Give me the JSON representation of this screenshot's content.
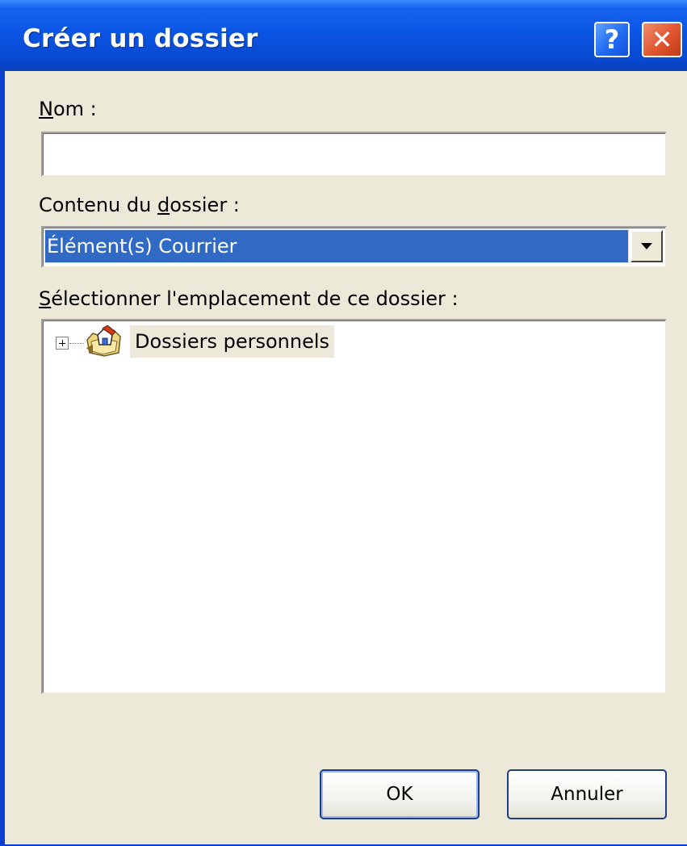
{
  "window": {
    "title": "Créer un dossier",
    "help_label": "?",
    "close_label": "✕"
  },
  "form": {
    "name_label_mnemonic": "N",
    "name_label_rest": "om :",
    "name_value": "",
    "content_label_before": "Contenu du ",
    "content_label_mnemonic": "d",
    "content_label_after": "ossier :",
    "content_selected": "Élément(s) Courrier",
    "location_label_mnemonic": "S",
    "location_label_rest": "électionner l'emplacement de ce dossier :"
  },
  "tree": {
    "items": [
      {
        "label": "Dossiers personnels",
        "icon": "personal-folders-icon",
        "expanded": false
      }
    ]
  },
  "buttons": {
    "ok_label": "OK",
    "cancel_label": "Annuler"
  },
  "colors": {
    "titlebar": "#0a55e3",
    "dialog_bg": "#ece9d8",
    "selection": "#316ac5",
    "close": "#e0552f"
  }
}
